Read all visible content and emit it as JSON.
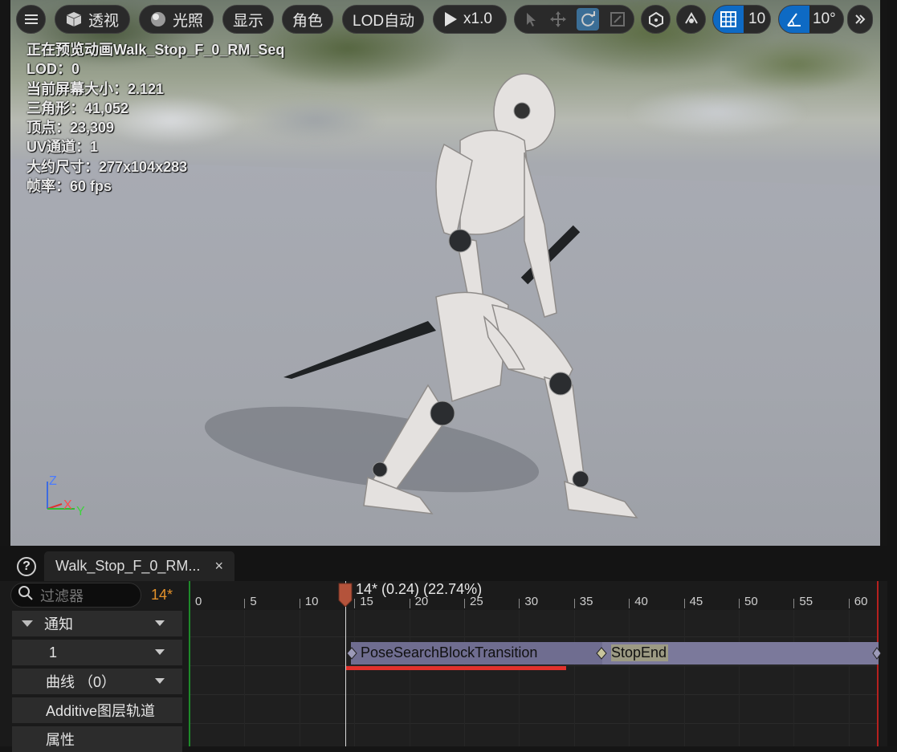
{
  "toolbar": {
    "menu_icon": "hamburger-icon",
    "perspective": "透视",
    "lighting": "光照",
    "show": "显示",
    "character": "角色",
    "lod": "LOD自动",
    "play_speed": "x1.0",
    "grid_snap_value": "10",
    "rotation_snap_value": "10°"
  },
  "stats": {
    "preview": "正在预览动画Walk_Stop_F_0_RM_Seq",
    "lod": "LOD：0",
    "screen_size": "当前屏幕大小：2.121",
    "triangles": "三角形：41,052",
    "vertices": "顶点：23,309",
    "uv_channels": "UV通道：1",
    "approx_size": "大约尺寸：277x104x283",
    "frame_rate": "帧率：60 fps"
  },
  "axes": {
    "z": "Z",
    "x": "X",
    "y": "Y"
  },
  "panel": {
    "tab_title": "Walk_Stop_F_0_RM...",
    "tab_close": "×",
    "filter_placeholder": "过滤器",
    "current_frame": "14*",
    "rows": {
      "notify": "通知",
      "track_1": "1",
      "curves": "曲线 （0）",
      "additive": "Additive图层轨道",
      "attributes": "属性"
    },
    "playhead_label": "14* (0.24) (22.74%)",
    "ruler_ticks": [
      "0",
      "5",
      "10",
      "15",
      "20",
      "25",
      "30",
      "35",
      "40",
      "45",
      "50",
      "55",
      "60"
    ],
    "notifies": [
      "PoseSearchBlockTransition",
      "StopEnd"
    ]
  },
  "colors": {
    "accent_blue": "#0e6ac4",
    "frame_orange": "#e5922a",
    "playhead": "#c0523a",
    "notify_bar": "#6f6d90",
    "error_red": "#e2312c"
  }
}
